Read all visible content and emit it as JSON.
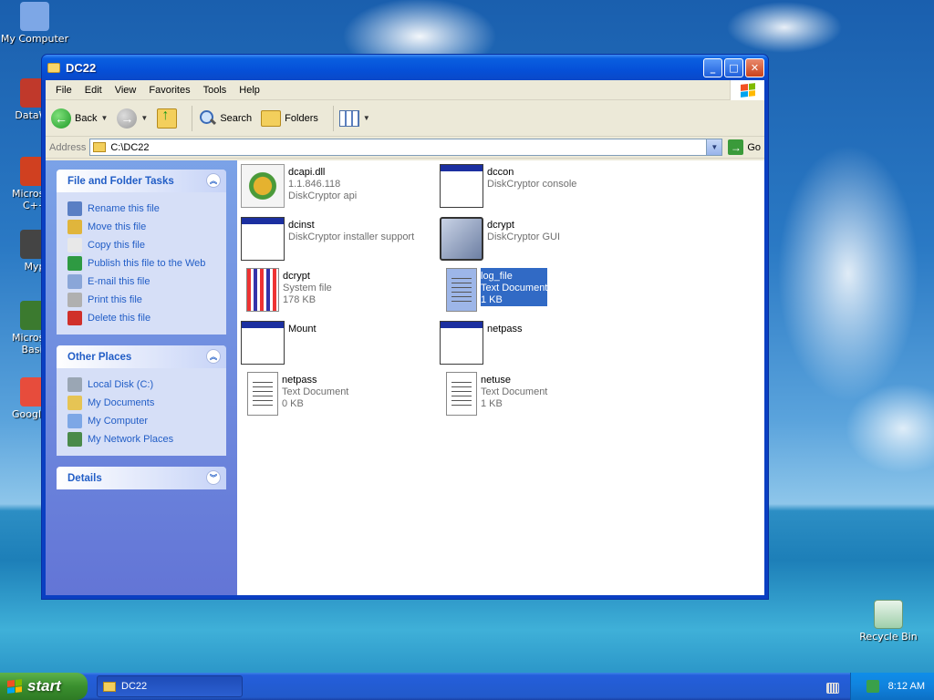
{
  "desktop": {
    "icons_left": [
      {
        "label": "My Computer",
        "icon": "my-computer-icon",
        "color": "#7da7e6"
      },
      {
        "label": "DataWa",
        "icon": "datawave-shortcut-icon",
        "color": "#c0392b"
      },
      {
        "label": "Microsoft C++",
        "icon": "microsoft-cpp-shortcut-icon",
        "color": "#d04020"
      },
      {
        "label": "Myp",
        "icon": "myp-shortcut-icon",
        "color": "#444"
      },
      {
        "label": "Microsoft Basic",
        "icon": "microsoft-basic-shortcut-icon",
        "color": "#3b7a2f"
      },
      {
        "label": "Google C",
        "icon": "google-chrome-shortcut-icon",
        "color": "#e74c3c"
      }
    ],
    "recycle_bin": "Recycle Bin"
  },
  "window": {
    "title": "DC22",
    "buttons": {
      "minimize": "_",
      "maximize": "□",
      "close": "✕"
    }
  },
  "menubar": [
    "File",
    "Edit",
    "View",
    "Favorites",
    "Tools",
    "Help"
  ],
  "toolbar": {
    "back": "Back",
    "search": "Search",
    "folders": "Folders"
  },
  "address": {
    "label": "Address",
    "value": "C:\\DC22",
    "go": "Go"
  },
  "taskpane": {
    "file_tasks": {
      "title": "File and Folder Tasks",
      "items": [
        {
          "label": "Rename this file",
          "icon": "rename-icon",
          "color": "#5a7fc4"
        },
        {
          "label": "Move this file",
          "icon": "move-icon",
          "color": "#e0b53c"
        },
        {
          "label": "Copy this file",
          "icon": "copy-icon",
          "color": "#e8e8e8"
        },
        {
          "label": "Publish this file to the Web",
          "icon": "publish-web-icon",
          "color": "#2e9a42"
        },
        {
          "label": "E-mail this file",
          "icon": "email-icon",
          "color": "#8aa6d8"
        },
        {
          "label": "Print this file",
          "icon": "print-icon",
          "color": "#b0b0b0"
        },
        {
          "label": "Delete this file",
          "icon": "delete-icon",
          "color": "#d0302a"
        }
      ]
    },
    "other_places": {
      "title": "Other Places",
      "items": [
        {
          "label": "Local Disk (C:)",
          "icon": "local-disk-icon",
          "color": "#9aa6b4"
        },
        {
          "label": "My Documents",
          "icon": "my-documents-icon",
          "color": "#e6c454"
        },
        {
          "label": "My Computer",
          "icon": "my-computer-icon",
          "color": "#7da7e6"
        },
        {
          "label": "My Network Places",
          "icon": "network-places-icon",
          "color": "#4a8a4a"
        }
      ]
    },
    "details": {
      "title": "Details"
    }
  },
  "files": [
    {
      "name": "dcapi.dll",
      "line2": "1.1.846.118",
      "line3": "DiskCryptor api",
      "icon": "dll-gear-icon",
      "selected": false
    },
    {
      "name": "dccon",
      "line2": "DiskCryptor console",
      "line3": "",
      "icon": "application-window-icon",
      "selected": false
    },
    {
      "name": "dcinst",
      "line2": "DiskCryptor installer support",
      "line3": "",
      "icon": "application-window-icon",
      "selected": false
    },
    {
      "name": "dcrypt",
      "line2": "DiskCryptor GUI",
      "line3": "",
      "icon": "diskcryptor-logo-icon",
      "selected": false
    },
    {
      "name": "dcrypt",
      "line2": "System file",
      "line3": "178 KB",
      "icon": "system-file-icon",
      "selected": false
    },
    {
      "name": "log_file",
      "line2": "Text Document",
      "line3": "1 KB",
      "icon": "text-document-icon",
      "selected": true
    },
    {
      "name": "Mount",
      "line2": "",
      "line3": "",
      "icon": "application-window-icon",
      "selected": false
    },
    {
      "name": "netpass",
      "line2": "",
      "line3": "",
      "icon": "application-window-icon",
      "selected": false
    },
    {
      "name": "netpass",
      "line2": "Text Document",
      "line3": "0 KB",
      "icon": "text-document-icon",
      "selected": false
    },
    {
      "name": "netuse",
      "line2": "Text Document",
      "line3": "1 KB",
      "icon": "text-document-icon",
      "selected": false
    }
  ],
  "taskbar": {
    "start": "start",
    "task_button": "DC22",
    "clock": "8:12 AM"
  }
}
